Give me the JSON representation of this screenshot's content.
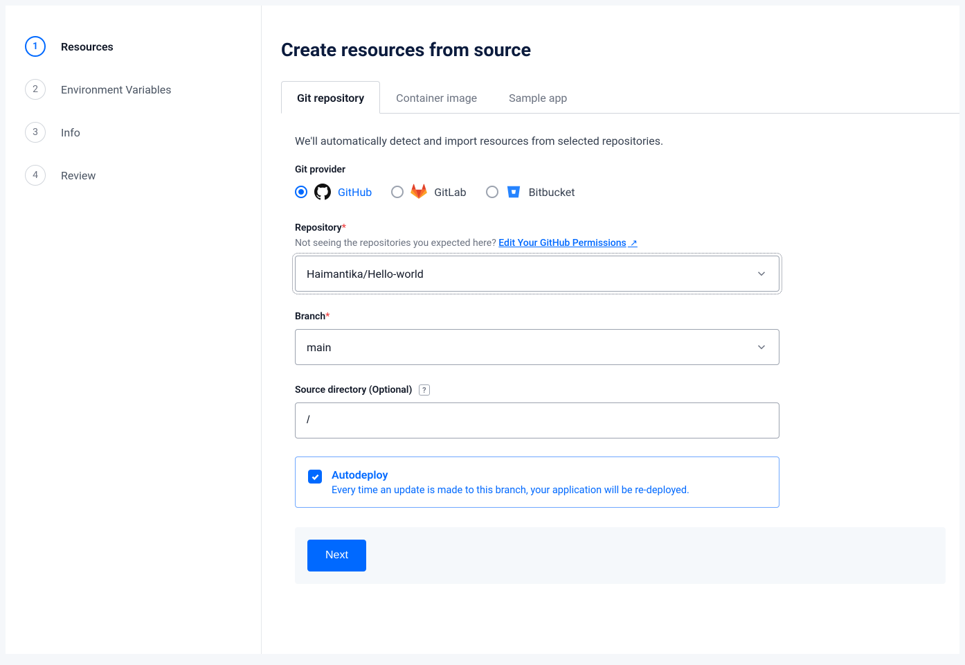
{
  "sidebar": {
    "steps": [
      {
        "num": "1",
        "label": "Resources",
        "active": true
      },
      {
        "num": "2",
        "label": "Environment Variables",
        "active": false
      },
      {
        "num": "3",
        "label": "Info",
        "active": false
      },
      {
        "num": "4",
        "label": "Review",
        "active": false
      }
    ]
  },
  "header": {
    "title": "Create resources from source"
  },
  "tabs": [
    {
      "label": "Git repository",
      "active": true
    },
    {
      "label": "Container image",
      "active": false
    },
    {
      "label": "Sample app",
      "active": false
    }
  ],
  "intro": "We'll automatically detect and import resources from selected repositories.",
  "provider": {
    "label": "Git provider",
    "options": [
      {
        "label": "GitHub",
        "selected": true
      },
      {
        "label": "GitLab",
        "selected": false
      },
      {
        "label": "Bitbucket",
        "selected": false
      }
    ]
  },
  "repository": {
    "label": "Repository",
    "hint_prefix": "Not seeing the repositories you expected here? ",
    "hint_link": "Edit Your GitHub Permissions",
    "value": "Haimantika/Hello-world"
  },
  "branch": {
    "label": "Branch",
    "value": "main"
  },
  "source_dir": {
    "label": "Source directory (Optional)",
    "value": "/"
  },
  "autodeploy": {
    "title": "Autodeploy",
    "desc": "Every time an update is made to this branch, your application will be re-deployed.",
    "checked": true
  },
  "footer": {
    "next": "Next"
  }
}
